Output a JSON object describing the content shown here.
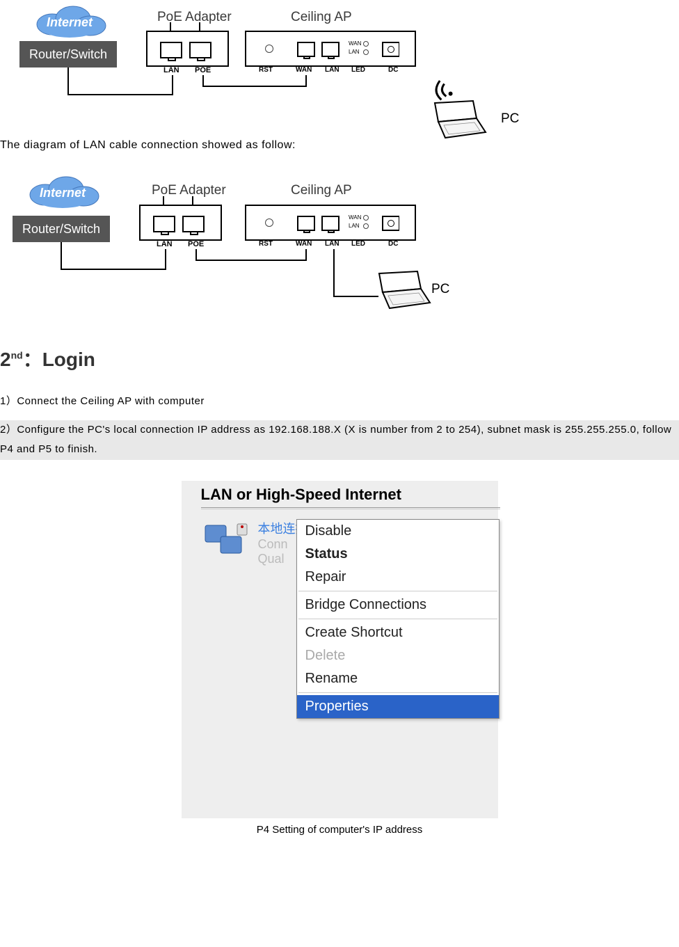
{
  "diagram": {
    "internet": "Internet",
    "router": "Router/Switch",
    "poe_adapter": "PoE Adapter",
    "ceiling_ap": "Ceiling AP",
    "pc": "PC",
    "lan": "LAN",
    "poe": "POE",
    "rst": "RST",
    "wan": "WAN",
    "led": "LED",
    "dc": "DC",
    "wan_s": "WAN",
    "lan_s": "LAN"
  },
  "text": {
    "sentence": "The diagram of LAN cable connection showed as follow:",
    "heading_pre": "2",
    "heading_sup": "nd",
    "heading_post": "：Login",
    "step1": "1）Connect the Ceiling AP with computer",
    "step2": "2）Configure the PC's local connection IP address as 192.168.188.X (X is number from 2 to 254),   subnet mask is 255.255.255.0, follow P4 and P5 to finish.",
    "caption": "P4   Setting of computer's IP address"
  },
  "p4": {
    "title": "LAN or High-Speed Internet",
    "zh": "本地连接",
    "conn": "Conn",
    "qual": "Qual",
    "menu": {
      "disable": "Disable",
      "status": "Status",
      "repair": "Repair",
      "bridge": "Bridge Connections",
      "shortcut": "Create Shortcut",
      "delete": "Delete",
      "rename": "Rename",
      "properties": "Properties"
    }
  }
}
